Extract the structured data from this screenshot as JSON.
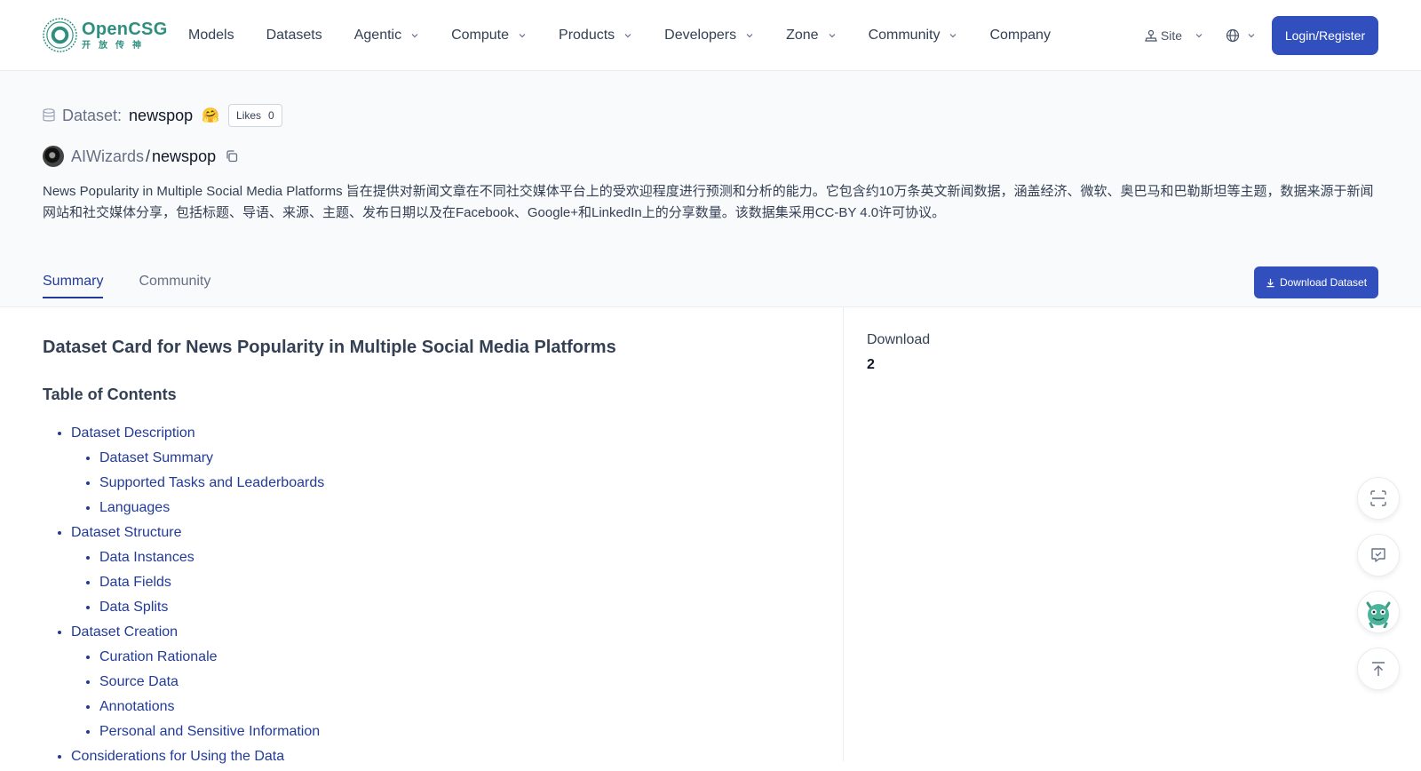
{
  "brand": {
    "name": "OpenCSG",
    "tagline": "开放传神"
  },
  "nav": {
    "items": [
      {
        "label": "Models",
        "dropdown": false
      },
      {
        "label": "Datasets",
        "dropdown": false
      },
      {
        "label": "Agentic",
        "dropdown": true
      },
      {
        "label": "Compute",
        "dropdown": true
      },
      {
        "label": "Products",
        "dropdown": true
      },
      {
        "label": "Developers",
        "dropdown": true
      },
      {
        "label": "Zone",
        "dropdown": true
      },
      {
        "label": "Community",
        "dropdown": true
      },
      {
        "label": "Company",
        "dropdown": false
      }
    ],
    "site_label": "Site",
    "login_label": "Login/Register"
  },
  "dataset": {
    "label": "Dataset:",
    "name": "newspop",
    "emoji": "🤗",
    "likes_label": "Likes",
    "likes_count": "0",
    "owner": "AIWizards",
    "separator": "/",
    "repo": "newspop",
    "description": "News Popularity in Multiple Social Media Platforms 旨在提供对新闻文章在不同社交媒体平台上的受欢迎程度进行预测和分析的能力。它包含约10万条英文新闻数据，涵盖经济、微软、奥巴马和巴勒斯坦等主题，数据来源于新闻网站和社交媒体分享，包括标题、导语、来源、主题、发布日期以及在Facebook、Google+和LinkedIn上的分享数量。该数据集采用CC-BY 4.0许可协议。"
  },
  "tabs": [
    {
      "label": "Summary",
      "active": true
    },
    {
      "label": "Community",
      "active": false
    }
  ],
  "download_button": "Download Dataset",
  "card": {
    "title": "Dataset Card for News Popularity in Multiple Social Media Platforms",
    "toc_title": "Table of Contents",
    "toc": [
      {
        "label": "Dataset Description",
        "children": [
          "Dataset Summary",
          "Supported Tasks and Leaderboards",
          "Languages"
        ]
      },
      {
        "label": "Dataset Structure",
        "children": [
          "Data Instances",
          "Data Fields",
          "Data Splits"
        ]
      },
      {
        "label": "Dataset Creation",
        "children": [
          "Curation Rationale",
          "Source Data",
          "Annotations",
          "Personal and Sensitive Information"
        ]
      },
      {
        "label": "Considerations for Using the Data",
        "children": []
      }
    ]
  },
  "side": {
    "download_label": "Download",
    "download_count": "2"
  },
  "colors": {
    "primary": "#3250bd",
    "link": "#223b99",
    "brand": "#2f8f7e"
  }
}
